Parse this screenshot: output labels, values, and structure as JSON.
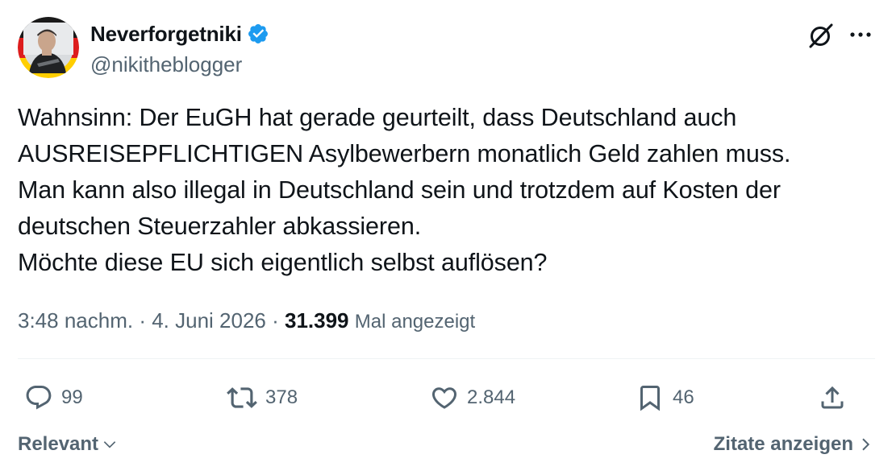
{
  "author": {
    "display_name": "Neverforgetniki",
    "handle": "@nikitheblogger",
    "verified": true,
    "avatar_icon": "profile-photo-with-german-flag-ring"
  },
  "header_actions": {
    "grok_icon": "grok-icon",
    "more_icon": "more-dots-icon"
  },
  "tweet": {
    "lines": [
      "Wahnsinn: Der EuGH hat gerade geurteilt, dass Deutschland auch",
      "AUSREISEPFLICHTIGEN Asylbewerbern monatlich Geld zahlen muss.",
      "Man kann also illegal in Deutschland sein und trotzdem auf Kosten der",
      "deutschen Steuerzahler abkassieren.",
      "Möchte diese EU sich eigentlich selbst auflösen?"
    ]
  },
  "meta": {
    "time": "3:48 nachm.",
    "separator": " · ",
    "date": "4. Juni 2026",
    "views_count": "31.399",
    "views_label": "Mal angezeigt"
  },
  "actions": {
    "reply_count": "99",
    "retweet_count": "378",
    "like_count": "2.844",
    "bookmark_count": "46"
  },
  "footer": {
    "sort_label": "Relevant",
    "quotes_label": "Zitate anzeigen"
  },
  "colors": {
    "text_primary": "#0f1419",
    "text_secondary": "#536471",
    "verified_blue": "#1d9bf0",
    "divider": "#eff3f4"
  }
}
